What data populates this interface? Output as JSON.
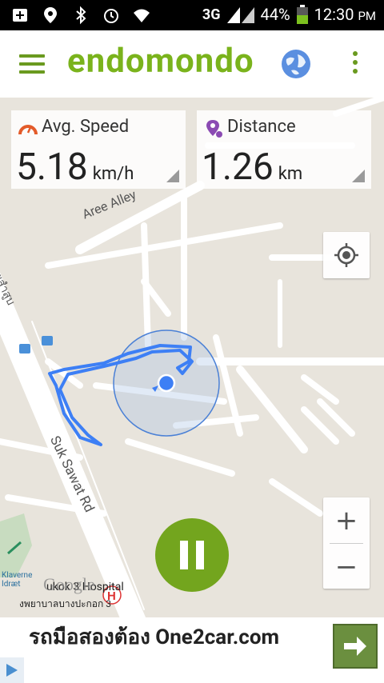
{
  "status_bar": {
    "battery": "44%",
    "time": "12:30",
    "ampm": "PM",
    "network": "3G"
  },
  "app": {
    "logo": "endomondo"
  },
  "stats": {
    "avg_speed": {
      "label": "Avg. Speed",
      "value": "5.18",
      "unit": "km/h"
    },
    "distance": {
      "label": "Distance",
      "value": "1.26",
      "unit": "km"
    }
  },
  "map": {
    "streets": [
      "Aree Alley",
      "Suk Sawat Rd",
      "ซอยสำสูบ"
    ],
    "poi": {
      "hospital": "ukok 3 Hospital",
      "hospital_th": "งพยาบาลบางปะกอก 3",
      "klaverne": "Klaverne\nIdræt"
    },
    "watermark": "Google"
  },
  "zoom": {
    "in": "+",
    "out": "−"
  },
  "ad": {
    "text": "รถมือสองต้อง One2car.com"
  },
  "colors": {
    "brand": "#7ab31c",
    "route": "#3d7ff5",
    "pause": "#73a51e"
  }
}
